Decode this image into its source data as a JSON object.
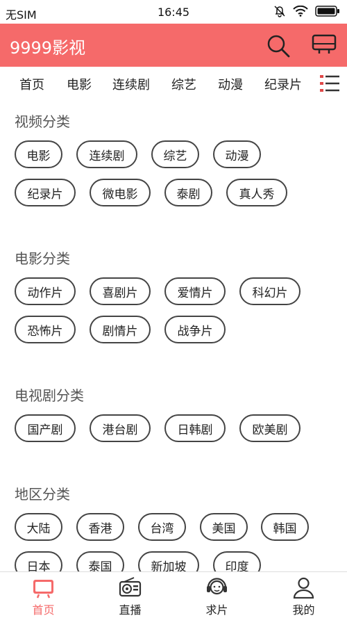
{
  "status_bar": {
    "carrier": "无SIM",
    "time": "16:45"
  },
  "app_bar": {
    "title": "9999影视"
  },
  "nav_tabs": [
    "首页",
    "电影",
    "连续剧",
    "综艺",
    "动漫",
    "纪录片"
  ],
  "sections": {
    "video": {
      "title": "视频分类",
      "chips": [
        "电影",
        "连续剧",
        "综艺",
        "动漫",
        "纪录片",
        "微电影",
        "泰剧",
        "真人秀"
      ]
    },
    "movie": {
      "title": "电影分类",
      "chips": [
        "动作片",
        "喜剧片",
        "爱情片",
        "科幻片",
        "恐怖片",
        "剧情片",
        "战争片"
      ]
    },
    "tv": {
      "title": "电视剧分类",
      "chips": [
        "国产剧",
        "港台剧",
        "日韩剧",
        "欧美剧"
      ]
    },
    "region": {
      "title": "地区分类",
      "chips": [
        "大陆",
        "香港",
        "台湾",
        "美国",
        "韩国",
        "日本",
        "泰国",
        "新加坡",
        "印度"
      ]
    }
  },
  "bottom_nav": [
    {
      "label": "首页",
      "icon": "tv-icon",
      "active": true
    },
    {
      "label": "直播",
      "icon": "radio-icon",
      "active": false
    },
    {
      "label": "求片",
      "icon": "headset-icon",
      "active": false
    },
    {
      "label": "我的",
      "icon": "user-icon",
      "active": false
    }
  ],
  "colors": {
    "accent": "#f56a6a",
    "chip_border": "#444444",
    "section_title": "#555555"
  }
}
